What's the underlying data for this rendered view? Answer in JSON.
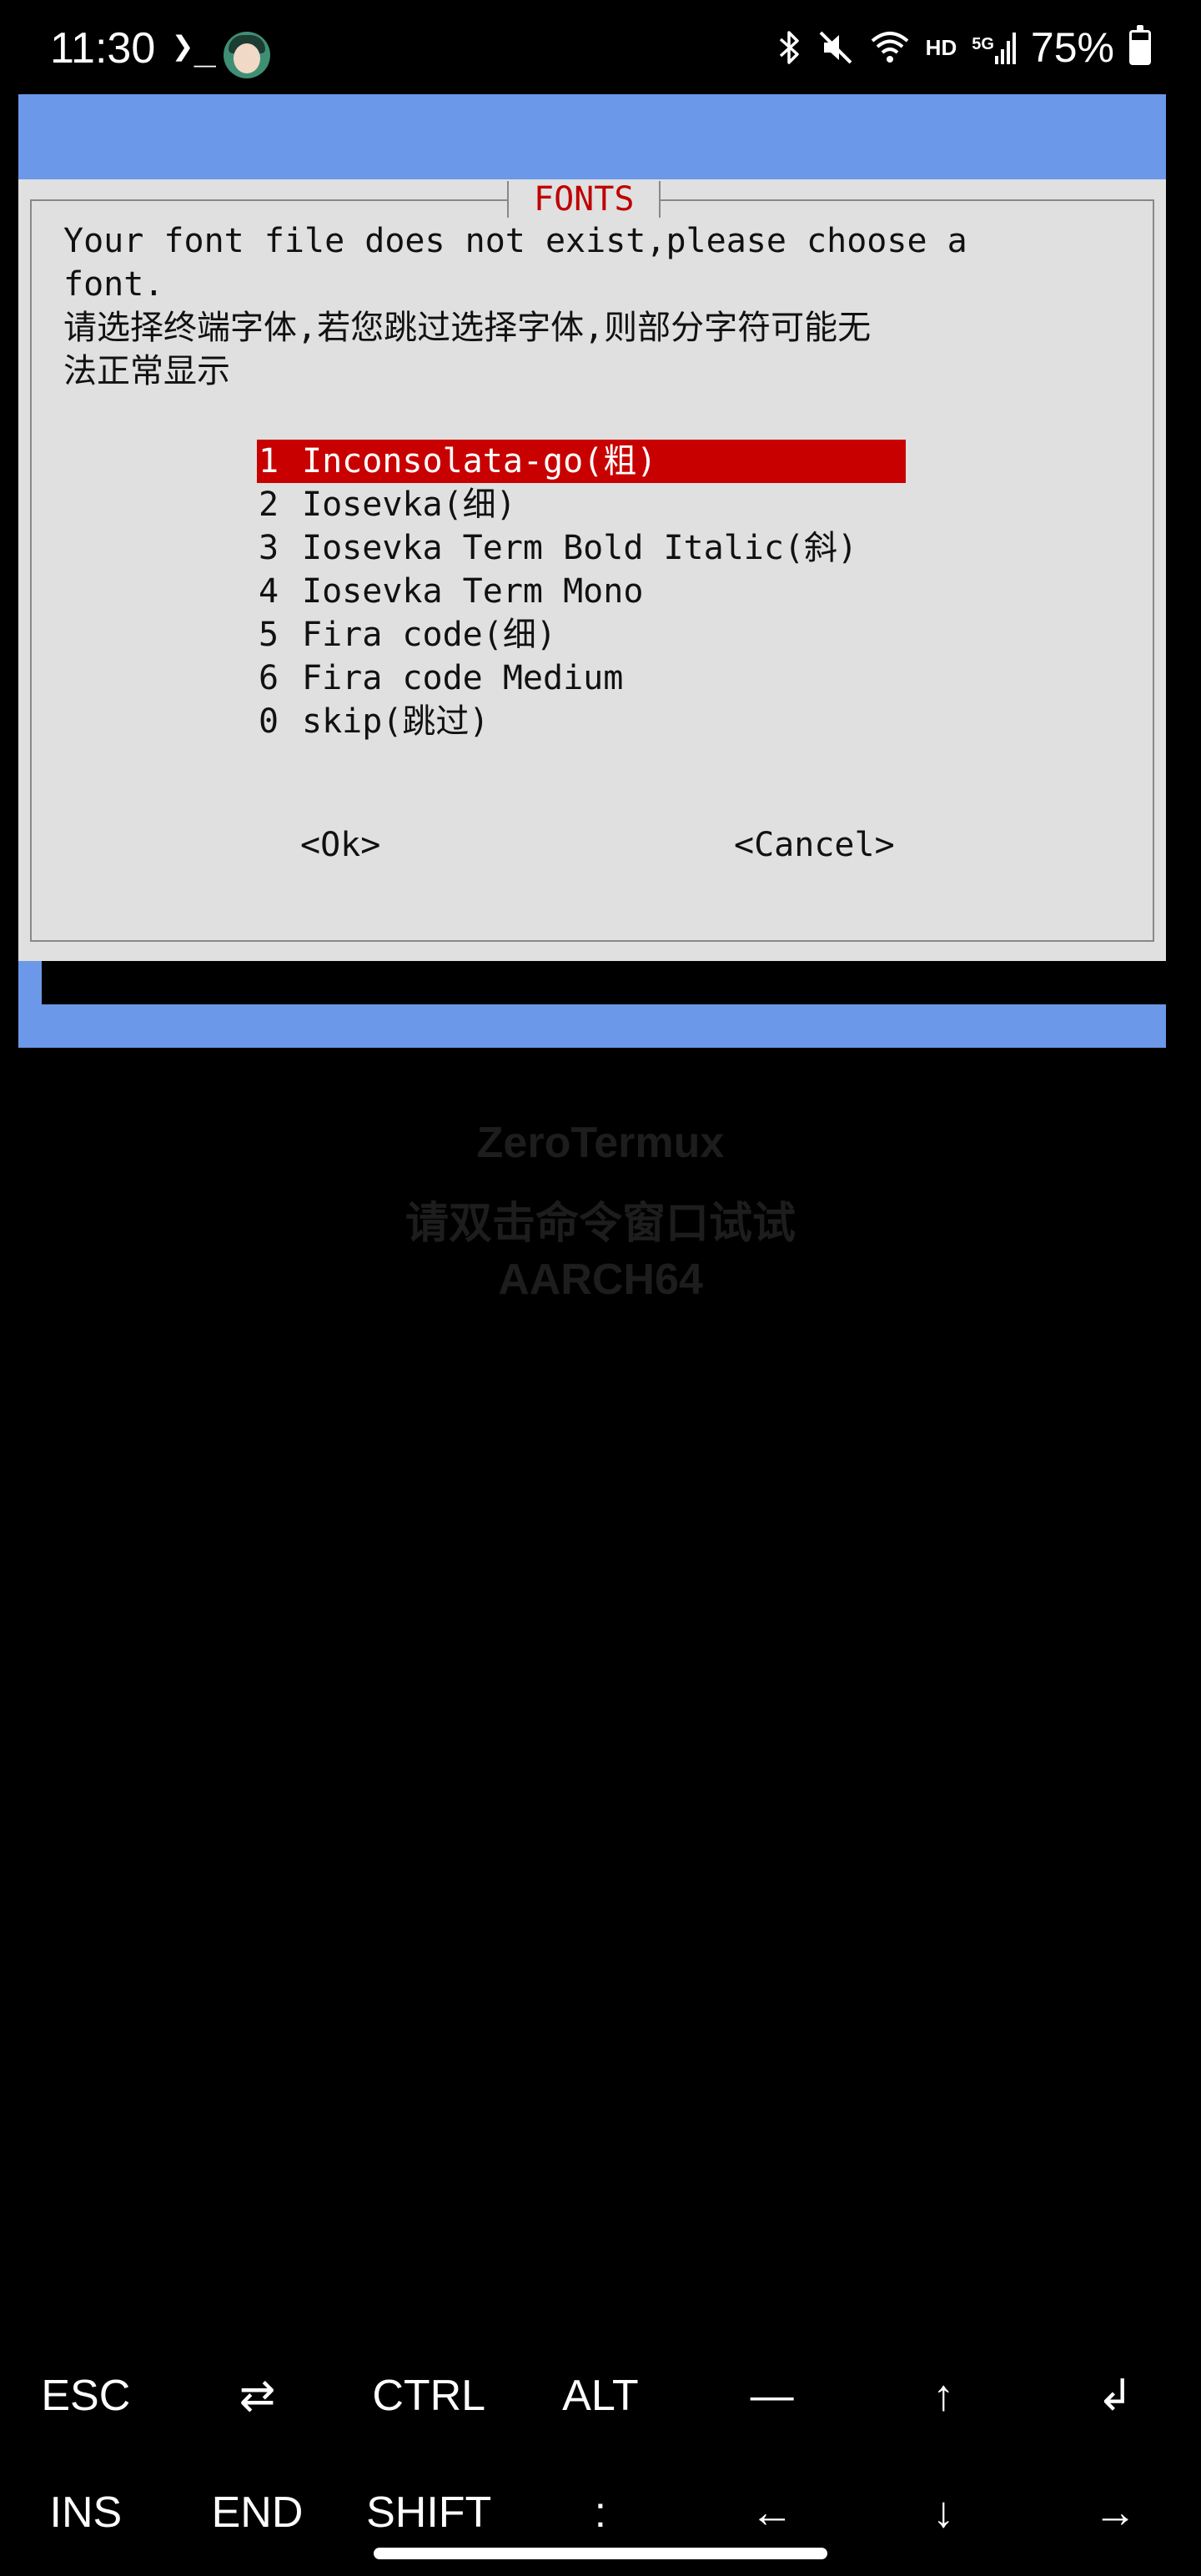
{
  "status_bar": {
    "time": "11:30",
    "prompt": "❯_",
    "battery_percent": "75%",
    "battery_level": 0.75,
    "hd_label": "HD",
    "network_label": "5G",
    "icons": [
      "terminal-icon",
      "avatar-icon",
      "bluetooth-icon",
      "mute-icon",
      "wifi-icon",
      "signal-icon",
      "battery-icon"
    ]
  },
  "dialog": {
    "title": "FONTS",
    "message_lines": [
      "Your font file does not exist,please choose a",
      "font.",
      "请选择终端字体,若您跳过选择字体,则部分字符可能无",
      "法正常显示"
    ],
    "items": [
      {
        "key": "1",
        "label": "Inconsolata-go(粗)",
        "selected": true
      },
      {
        "key": "2",
        "label": "Iosevka(细)"
      },
      {
        "key": "3",
        "label": "Iosevka Term Bold Italic(斜)"
      },
      {
        "key": "4",
        "label": "Iosevka Term Mono"
      },
      {
        "key": "5",
        "label": "Fira code(细)"
      },
      {
        "key": "6",
        "label": "Fira code Medium"
      },
      {
        "key": "0",
        "label": "skip(跳过)"
      }
    ],
    "ok_label": "<Ok>",
    "cancel_label": "<Cancel>"
  },
  "watermark": {
    "line1": "ZeroTermux",
    "line2": "请双击命令窗口试试",
    "line3": "AARCH64"
  },
  "extra_keys": {
    "row1": [
      "ESC",
      "⇄",
      "CTRL",
      "ALT",
      "—",
      "↑",
      "↲"
    ],
    "row2": [
      "INS",
      "END",
      "SHIFT",
      ":",
      "←",
      "↓",
      "→"
    ]
  },
  "colors": {
    "terminal_blue": "#6b98e9",
    "dialog_gray": "#e0e0e0",
    "selection_red": "#c80000",
    "title_red": "#c00000"
  }
}
